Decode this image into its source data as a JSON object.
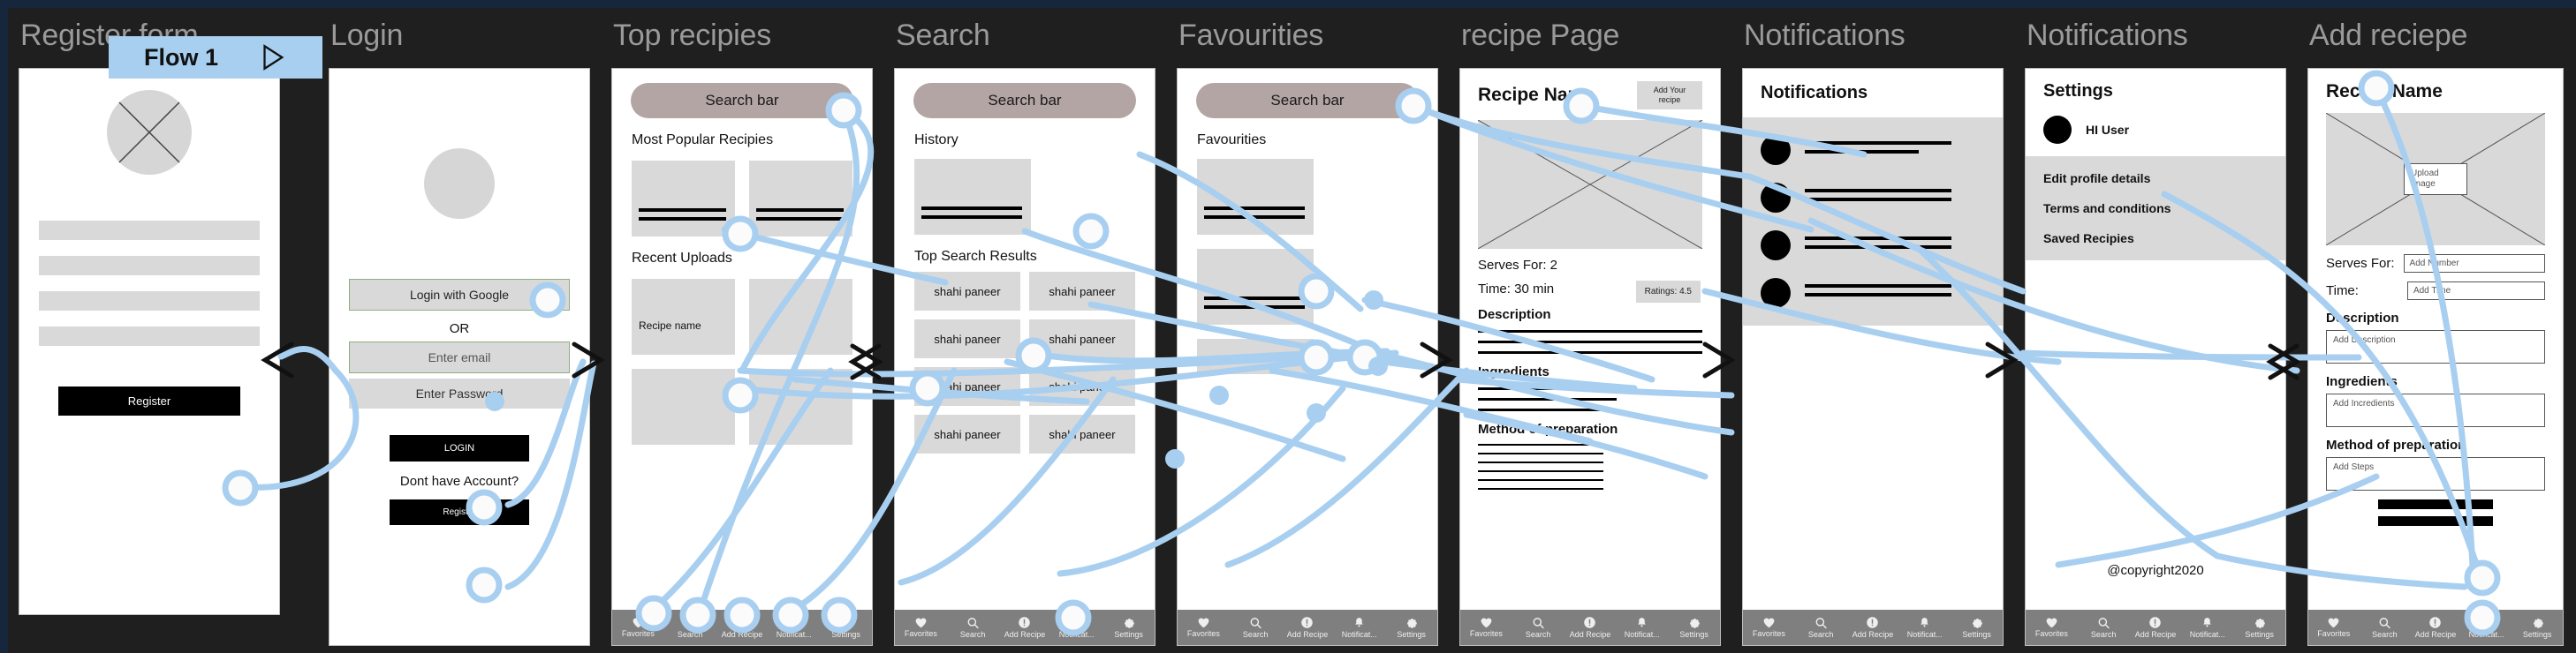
{
  "flow_badge": {
    "label": "Flow 1",
    "arrow_icon": "play-triangle-icon"
  },
  "nav": {
    "items": [
      {
        "label": "Favorites",
        "icon": "heart-icon"
      },
      {
        "label": "Search",
        "icon": "search-icon"
      },
      {
        "label": "Add Recipe",
        "icon": "exclamation-circle-icon"
      },
      {
        "label": "Notificat...",
        "icon": "bell-icon"
      },
      {
        "label": "Settings",
        "icon": "gear-icon"
      }
    ]
  },
  "frames": [
    {
      "title": "Register form",
      "register_button": "Register"
    },
    {
      "title": "Login",
      "google_button": "Login with Google",
      "or": "OR",
      "email_placeholder": "Enter email",
      "password_placeholder": "Enter Password",
      "login_button": "LOGIN",
      "no_account": "Dont have Account?",
      "register_button": "Register"
    },
    {
      "title": "Top recipies",
      "search_bar": "Search bar",
      "section_popular": "Most Popular Recipies",
      "section_recent": "Recent Uploads",
      "recipe_name": "Recipe name"
    },
    {
      "title": "Search",
      "search_bar": "Search bar",
      "section_history": "History",
      "section_results": "Top Search Results",
      "result_cells": [
        "shahi paneer",
        "shahi paneer",
        "shahi paneer",
        "shahi paneer",
        "shahi paneer",
        "shahi paneer",
        "shahi paneer",
        "shahi paneer"
      ]
    },
    {
      "title": "Favourities",
      "search_bar": "Search bar",
      "section_favourites": "Favourities"
    },
    {
      "title": "recipe Page",
      "recipe_name": "Recipe Name",
      "add_your_recipe": "Add Your recipe",
      "serves_for": "Serves For: 2",
      "time": "Time: 30 min",
      "ratings": "Ratings: 4.5",
      "description": "Description",
      "ingredients": "Ingredients",
      "method": "Method of preparation"
    },
    {
      "title": "Notifications",
      "heading": "Notifications"
    },
    {
      "title": "Notifications",
      "heading": "Settings",
      "user_greeting": "HI User",
      "items": [
        "Edit profile details",
        "Terms and conditions",
        "Saved Recipies"
      ],
      "copyright": "@copyright2020"
    },
    {
      "title": "Add reciepe",
      "recipe_name": "Recipe Name",
      "upload_image": "Upload Image",
      "serves_for_label": "Serves For:",
      "serves_for_placeholder": "Add Number",
      "time_label": "Time:",
      "time_placeholder": "Add Time",
      "description_label": "Description",
      "description_placeholder": "Add Description",
      "ingredients_label": "Ingredients",
      "ingredients_placeholder": "Add Incredients",
      "method_label": "Method of preparation",
      "method_placeholder": "Add Steps"
    }
  ],
  "colors": {
    "board_bg": "#1f1f1f",
    "navy": "#16273d",
    "title_text": "#9a9a9a",
    "wire": "#a8cff0",
    "searchbar": "#b3a5a4",
    "placeholder_gray": "#d9d9d9",
    "nav_bar": "#7f7f7f",
    "flow_badge": "#a8cff0"
  }
}
